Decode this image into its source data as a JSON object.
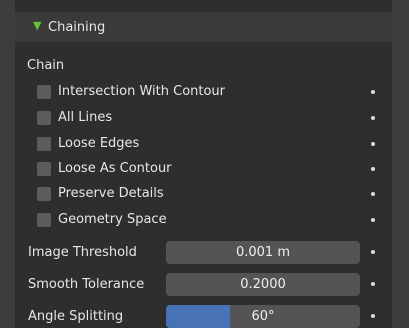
{
  "panel": {
    "header": "Chaining",
    "section": "Chain"
  },
  "checkboxes": [
    {
      "label": "Intersection With Contour",
      "checked": false
    },
    {
      "label": "All Lines",
      "checked": false
    },
    {
      "label": "Loose Edges",
      "checked": false
    },
    {
      "label": "Loose As Contour",
      "checked": false
    },
    {
      "label": "Preserve Details",
      "checked": false
    },
    {
      "label": "Geometry Space",
      "checked": false
    }
  ],
  "fields": {
    "image_threshold": {
      "label": "Image Threshold",
      "value": "0.001 m"
    },
    "smooth_tolerance": {
      "label": "Smooth Tolerance",
      "value": "0.2000"
    },
    "angle_splitting": {
      "label": "Angle Splitting",
      "value": "60°",
      "fill_fraction": 0.33
    }
  },
  "colors": {
    "panel_bg": "#2e2e2e",
    "field_bg": "#545454",
    "accent": "#4772b3",
    "disclosure": "#68c23a"
  },
  "icons": {
    "disclosure": "triangle-down-icon",
    "keyframe": "decorate-dot-icon"
  }
}
